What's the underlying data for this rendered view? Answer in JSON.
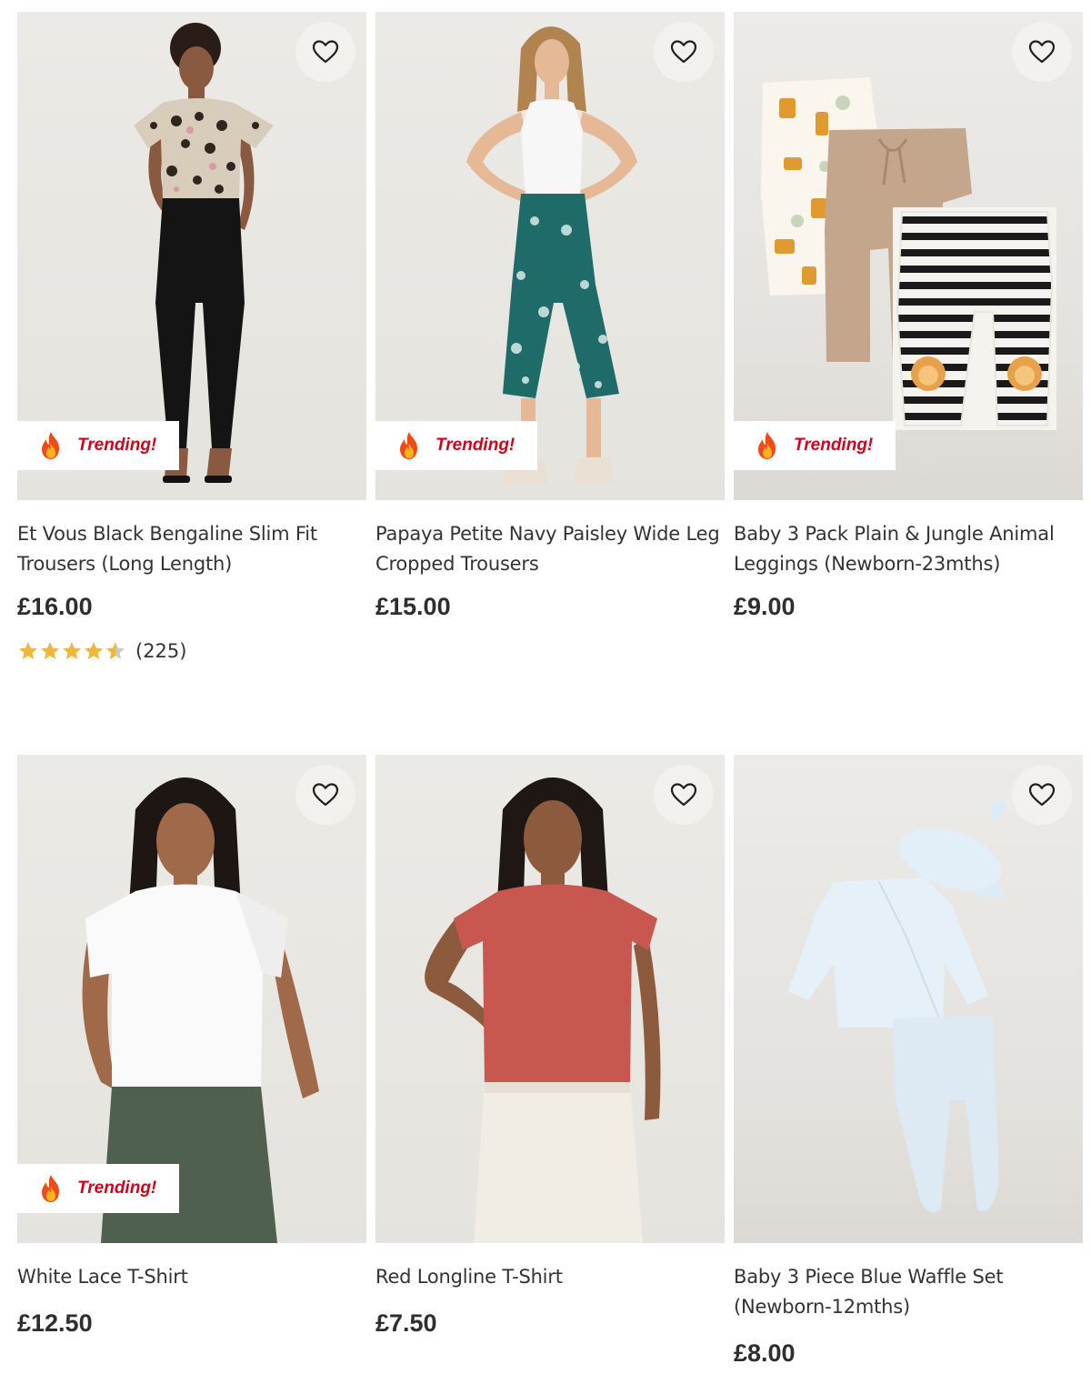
{
  "products": [
    {
      "title": "Et Vous Black Bengaline Slim Fit Trousers (Long Length)",
      "price": "£16.00",
      "badge": "Trending!",
      "rating": 4.5,
      "review_count": "(225)",
      "wishlist_icon": "heart-outline-icon"
    },
    {
      "title": "Papaya Petite Navy Paisley Wide Leg Cropped Trousers",
      "price": "£15.00",
      "badge": "Trending!",
      "wishlist_icon": "heart-outline-icon"
    },
    {
      "title": "Baby 3 Pack Plain & Jungle Animal Leggings (Newborn-23mths)",
      "price": "£9.00",
      "badge": "Trending!",
      "wishlist_icon": "heart-outline-icon"
    },
    {
      "title": "White Lace T-Shirt",
      "price": "£12.50",
      "badge": "Trending!",
      "wishlist_icon": "heart-outline-icon"
    },
    {
      "title": "Red Longline T-Shirt",
      "price": "£7.50",
      "wishlist_icon": "heart-outline-icon"
    },
    {
      "title": "Baby 3 Piece Blue Waffle Set (Newborn-12mths)",
      "price": "£8.00",
      "wishlist_icon": "heart-outline-icon"
    }
  ],
  "colors": {
    "badge_text": "#d0021b",
    "star": "#f0b73a",
    "wishlist_bg": "#f3f1ee"
  }
}
